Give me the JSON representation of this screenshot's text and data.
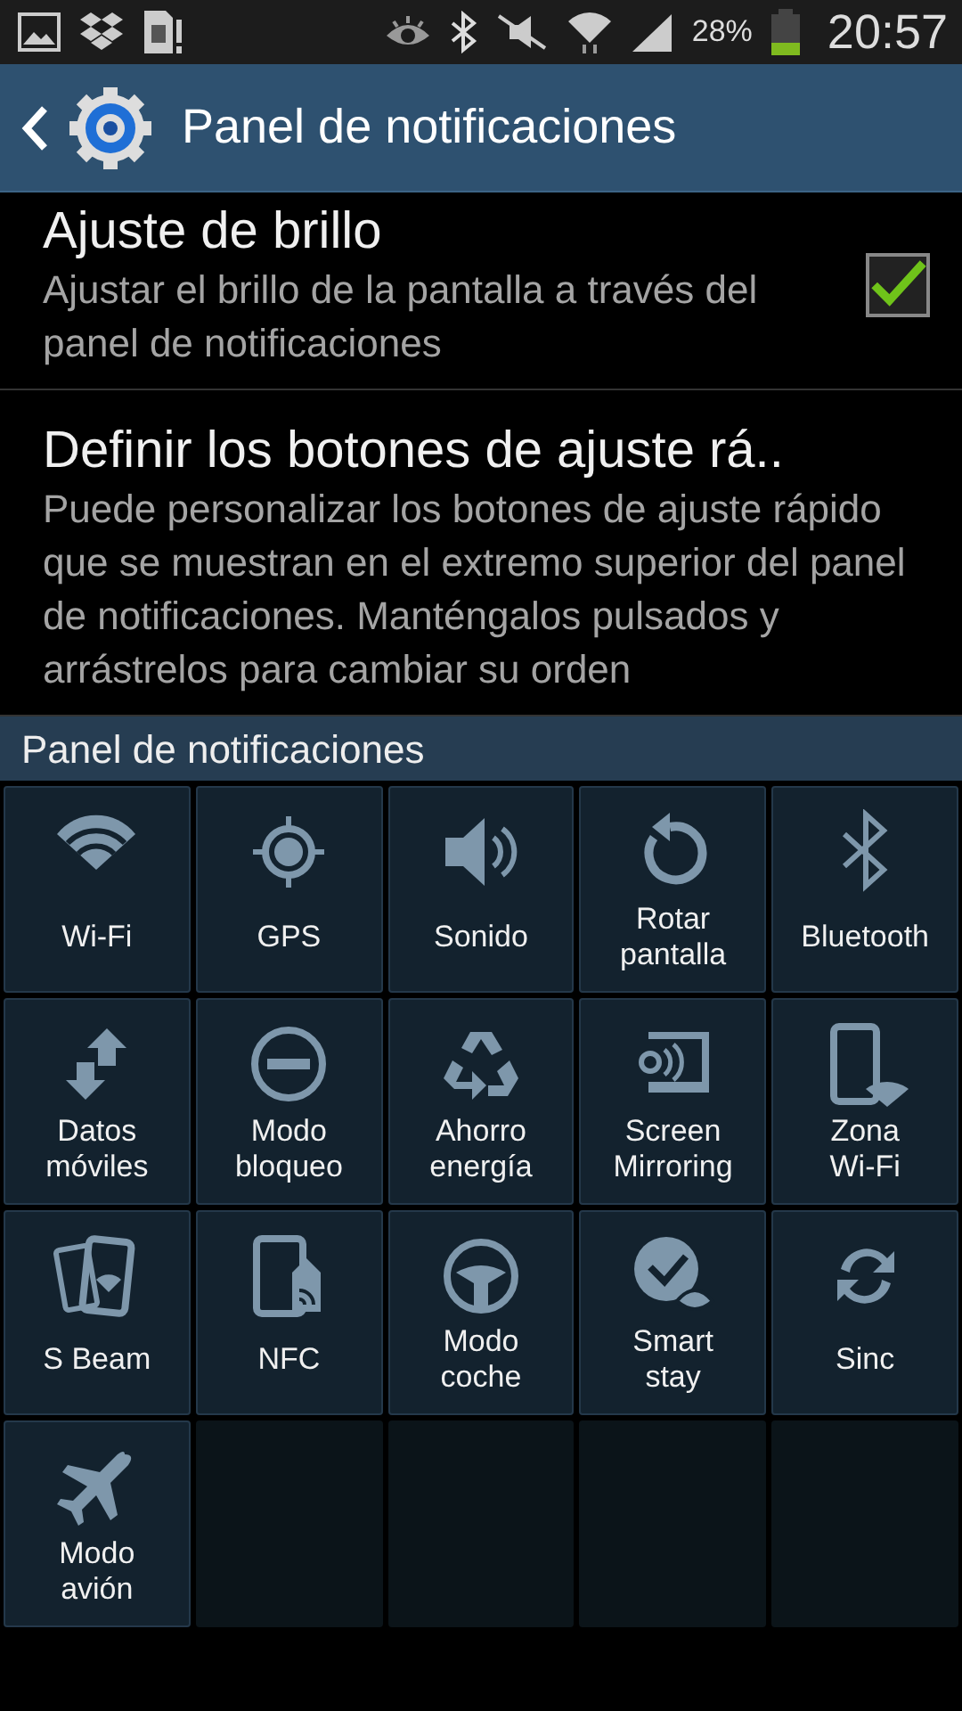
{
  "status_bar": {
    "battery_text": "28%",
    "time": "20:57"
  },
  "header": {
    "title": "Panel de notificaciones"
  },
  "settings": [
    {
      "title": "Ajuste de brillo",
      "description": "Ajustar el brillo de la pantalla a través del panel de notificaciones",
      "checked": true
    },
    {
      "title": "Definir los botones de ajuste rá..",
      "description": "Puede personalizar los botones de ajuste rápido que se muestran en el extremo superior del panel de notificaciones. Manténgalos pulsados y arrástrelos para cambiar su orden"
    }
  ],
  "section": {
    "title": "Panel de notificaciones"
  },
  "tiles": [
    {
      "label": "Wi-Fi",
      "kind": "wifi"
    },
    {
      "label": "GPS",
      "kind": "gps"
    },
    {
      "label": "Sonido",
      "kind": "sound"
    },
    {
      "label": "Rotar\npantalla",
      "kind": "rotate"
    },
    {
      "label": "Bluetooth",
      "kind": "bluetooth"
    },
    {
      "label": "Datos\nmóviles",
      "kind": "data"
    },
    {
      "label": "Modo\nbloqueo",
      "kind": "block"
    },
    {
      "label": "Ahorro\nenergía",
      "kind": "recycle"
    },
    {
      "label": "Screen\nMirroring",
      "kind": "mirror"
    },
    {
      "label": "Zona\nWi-Fi",
      "kind": "hotspot"
    },
    {
      "label": "S Beam",
      "kind": "sbeam"
    },
    {
      "label": "NFC",
      "kind": "nfc"
    },
    {
      "label": "Modo\ncoche",
      "kind": "car"
    },
    {
      "label": "Smart\nstay",
      "kind": "smartstay"
    },
    {
      "label": "Sinc",
      "kind": "sync"
    },
    {
      "label": "Modo\navión",
      "kind": "plane"
    }
  ]
}
